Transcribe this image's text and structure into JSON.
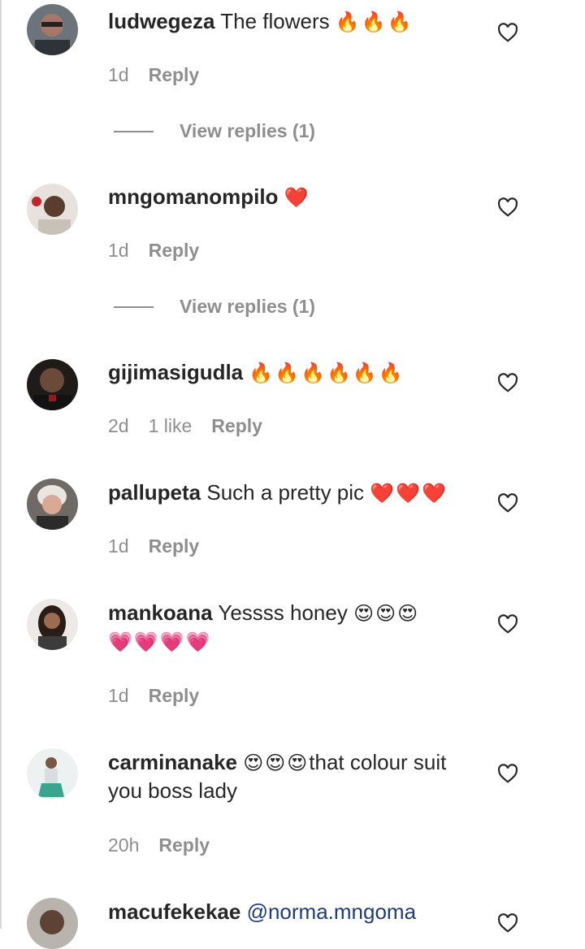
{
  "comments": [
    {
      "user": "ludwegeza",
      "text": "The flowers ",
      "emoji": "🔥🔥🔥",
      "time": "1d",
      "likes": "",
      "reply": "Reply",
      "view_replies": "View replies (1)",
      "avatar_color": "#5a5f66"
    },
    {
      "user": "mngomanompilo",
      "text": "",
      "emoji": "❤️",
      "time": "1d",
      "likes": "",
      "reply": "Reply",
      "view_replies": "View replies (1)",
      "avatar_color": "#c9b9b2"
    },
    {
      "user": "gijimasigudla",
      "text": "",
      "emoji": "🔥🔥🔥🔥🔥🔥",
      "time": "2d",
      "likes": "1 like",
      "reply": "Reply",
      "view_replies": "",
      "avatar_color": "#3b2f2a"
    },
    {
      "user": "pallupeta",
      "text": "Such a pretty pic ",
      "emoji": "❤️❤️❤️",
      "time": "1d",
      "likes": "",
      "reply": "Reply",
      "view_replies": "",
      "avatar_color": "#d9d3cf"
    },
    {
      "user": "mankoana",
      "text": "Yessss honey ",
      "emoji": "😍😍😍",
      "emoji2": "💗💗💗💗",
      "time": "1d",
      "likes": "",
      "reply": "Reply",
      "view_replies": "",
      "avatar_color": "#4a3a33"
    },
    {
      "user": "carminanake",
      "text": "that colour suit you boss lady",
      "emoji": "😍😍😍",
      "time": "20h",
      "likes": "",
      "reply": "Reply",
      "view_replies": "",
      "avatar_color": "#9fb8c8"
    },
    {
      "user": "macufekekae",
      "text": "",
      "mention": "@norma.mngoma",
      "time": "",
      "likes": "",
      "reply": "",
      "view_replies": "",
      "avatar_color": "#8a8580"
    }
  ],
  "colors": {
    "text": "#262626",
    "muted": "#8e8e8e",
    "mention": "#1f3c76"
  },
  "icons": {
    "like": "heart-outline-icon",
    "replies_divider": "line"
  }
}
